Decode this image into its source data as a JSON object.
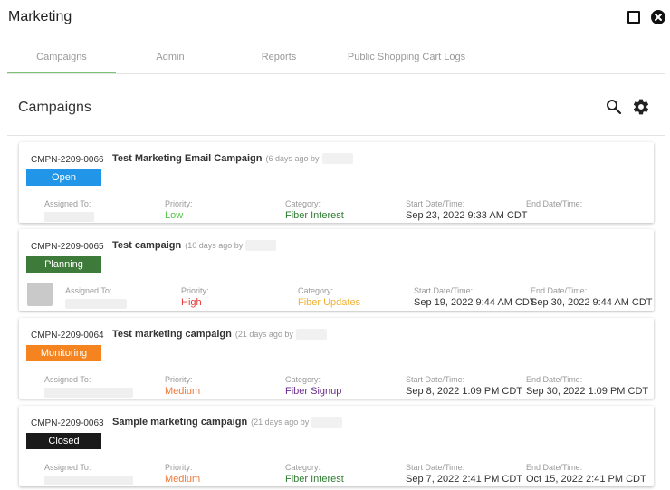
{
  "window": {
    "title": "Marketing"
  },
  "tabs": [
    {
      "label": "Campaigns"
    },
    {
      "label": "Admin"
    },
    {
      "label": "Reports"
    },
    {
      "label": "Public Shopping Cart Logs"
    }
  ],
  "section": {
    "title": "Campaigns"
  },
  "field_labels": {
    "assigned_to": "Assigned To:",
    "priority": "Priority:",
    "category": "Category:",
    "start": "Start Date/Time:",
    "end": "End Date/Time:"
  },
  "campaigns": [
    {
      "id": "CMPN-2209-0066",
      "title": "Test Marketing Email Campaign",
      "meta": "(6 days ago by",
      "status": "Open",
      "priority": "Low",
      "category": "Fiber Interest",
      "start": "Sep 23, 2022 9:33 AM CDT",
      "end": ""
    },
    {
      "id": "CMPN-2209-0065",
      "title": "Test campaign",
      "meta": "(10 days ago by",
      "status": "Planning",
      "priority": "High",
      "category": "Fiber Updates",
      "start": "Sep 19, 2022 9:44 AM CDT",
      "end": "Sep 30, 2022 9:44 AM CDT"
    },
    {
      "id": "CMPN-2209-0064",
      "title": "Test marketing campaign",
      "meta": "(21 days ago by",
      "status": "Monitoring",
      "priority": "Medium",
      "category": "Fiber Signup",
      "start": "Sep 8, 2022 1:09 PM CDT",
      "end": "Sep 30, 2022 1:09 PM CDT"
    },
    {
      "id": "CMPN-2209-0063",
      "title": "Sample marketing campaign",
      "meta": "(21 days ago by",
      "status": "Closed",
      "priority": "Medium",
      "category": "Fiber Interest",
      "start": "Sep 7, 2022 2:41 PM CDT",
      "end": "Oct 15, 2022 2:41 PM CDT"
    }
  ],
  "colors": {
    "status_open": "#2196e8",
    "status_planning": "#3e7a3a",
    "status_monitoring": "#f5831f",
    "status_closed": "#1a1a1a",
    "priority_low": "#55c44a",
    "priority_high": "#e53935",
    "priority_medium": "#f07838",
    "category_fiber_interest": "#2e7d32",
    "category_fiber_updates": "#f2b134",
    "category_fiber_signup": "#6a2c8c",
    "tab_active_underline": "#7cc378"
  },
  "icons": {
    "maximize": "maximize-icon",
    "close": "close-icon",
    "search": "search-icon",
    "settings": "gear-icon"
  }
}
